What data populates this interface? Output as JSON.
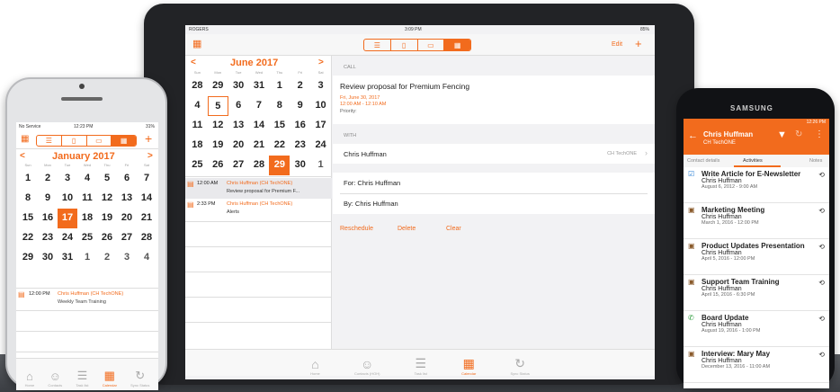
{
  "left_phone": {
    "status_left": "No Service",
    "status_time": "12:23 PM",
    "status_right": "31%",
    "month_title": "January 2017",
    "prev": "<",
    "next": ">",
    "add": "+",
    "dow": [
      "Sun",
      "Mon",
      "Tue",
      "Wed",
      "Thu",
      "Fri",
      "Sat"
    ],
    "days": [
      "1",
      "2",
      "3",
      "4",
      "5",
      "6",
      "7",
      "8",
      "9",
      "10",
      "11",
      "12",
      "13",
      "14",
      "15",
      "16",
      "17",
      "18",
      "19",
      "20",
      "21",
      "22",
      "23",
      "24",
      "25",
      "26",
      "27",
      "28",
      "29",
      "30",
      "31",
      "1",
      "2",
      "3",
      "4"
    ],
    "event_time": "12:00 PM",
    "event_who": "Chris Huffman (CH TechONE)",
    "event_title": "Weekly Team Training",
    "tabs": [
      "Home",
      "Contacts",
      "Task list",
      "Calendar",
      "Sync Status"
    ]
  },
  "tablet": {
    "status_left": "ROGERS",
    "status_time": "3:09 PM",
    "status_right": "85%",
    "edit": "Edit",
    "add": "+",
    "month_title": "June 2017",
    "prev": "<",
    "next": ">",
    "dow": [
      "Sun",
      "Mon",
      "Tue",
      "Wed",
      "Thu",
      "Fri",
      "Sat"
    ],
    "days": [
      "28",
      "29",
      "30",
      "31",
      "1",
      "2",
      "3",
      "4",
      "5",
      "6",
      "7",
      "8",
      "9",
      "10",
      "11",
      "12",
      "13",
      "14",
      "15",
      "16",
      "17",
      "18",
      "19",
      "20",
      "21",
      "22",
      "23",
      "24",
      "25",
      "26",
      "27",
      "28",
      "29",
      "30",
      "1"
    ],
    "events": [
      {
        "time": "12:00 AM",
        "who": "Chris Huffman (CH TechONE)",
        "title": "Review proposal for Premium F..."
      },
      {
        "time": "2:33 PM",
        "who": "Chris Huffman (CH TechONE)",
        "title": "Alerts"
      }
    ],
    "detail": {
      "type": "CALL",
      "title": "Review proposal for Premium Fencing",
      "date": "Fri, June 30, 2017",
      "time": "12:00 AM - 12:10 AM",
      "priority": "Priority:",
      "with_label": "WITH",
      "with_name": "Chris Huffman",
      "with_company": "CH TechONE",
      "for": "For:  Chris Huffman",
      "by": "By:  Chris Huffman",
      "reschedule": "Reschedule",
      "delete": "Delete",
      "clear": "Clear"
    },
    "tabs": [
      "Home",
      "Contacts (HOH)",
      "Task list",
      "Calendar",
      "Sync Status"
    ]
  },
  "right_phone": {
    "brand": "SAMSUNG",
    "status_time": "12:26 PM",
    "name": "Chris Huffman",
    "company": "CH TechONE",
    "tabs": [
      "Contact details",
      "Activities",
      "Notes"
    ],
    "activities": [
      {
        "title": "Write Article for E-Newsletter",
        "who": "Chris Huffman",
        "when": "August 6, 2012 - 9:00 AM"
      },
      {
        "title": "Marketing Meeting",
        "who": "Chris Huffman",
        "when": "March 1, 2016 - 12:00 PM"
      },
      {
        "title": "Product Updates Presentation",
        "who": "Chris Huffman",
        "when": "April 5, 2016 - 12:00 PM"
      },
      {
        "title": "Support Team Training",
        "who": "Chris Huffman",
        "when": "April 15, 2016 - 6:30 PM"
      },
      {
        "title": "Board Update",
        "who": "Chris Huffman",
        "when": "August 19, 2016 - 1:00 PM"
      },
      {
        "title": "Interview: Mary May",
        "who": "Chris Huffman",
        "when": "December 13, 2016 - 11:00 AM"
      }
    ]
  },
  "colors": {
    "accent": "#f26b1d",
    "device": "#1c1d20"
  }
}
